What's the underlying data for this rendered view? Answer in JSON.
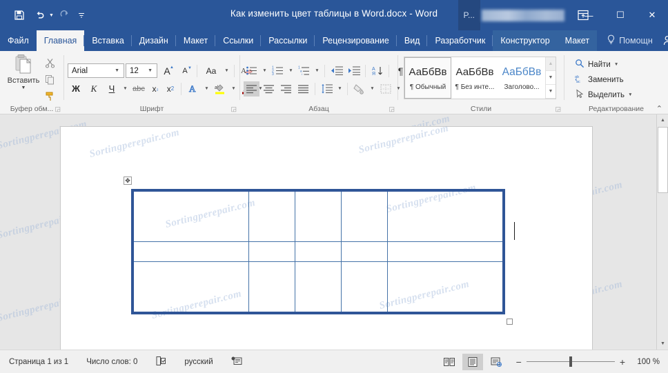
{
  "window": {
    "title": "Как изменить цвет таблицы в Word.docx  -  Word",
    "account_label": "P...",
    "quick_access": [
      {
        "name": "save",
        "icon": "save-icon"
      },
      {
        "name": "undo",
        "icon": "undo-icon"
      },
      {
        "name": "redo",
        "icon": "redo-icon"
      },
      {
        "name": "customize",
        "icon": "customize-qat-icon"
      }
    ],
    "controls": {
      "ribbon_display": "⊞",
      "minimize": "—",
      "maximize": "☐",
      "close": "✕"
    }
  },
  "tabs": [
    {
      "label": "Файл",
      "active": false
    },
    {
      "label": "Главная",
      "active": true
    },
    {
      "label": "Вставка",
      "active": false
    },
    {
      "label": "Дизайн",
      "active": false
    },
    {
      "label": "Макет",
      "active": false
    },
    {
      "label": "Ссылки",
      "active": false
    },
    {
      "label": "Рассылки",
      "active": false
    },
    {
      "label": "Рецензирование",
      "active": false
    },
    {
      "label": "Вид",
      "active": false
    },
    {
      "label": "Разработчик",
      "active": false
    }
  ],
  "contextual_tabs": [
    {
      "label": "Конструктор"
    },
    {
      "label": "Макет"
    }
  ],
  "helper": {
    "label": "Помощн",
    "icon": "lightbulb-icon"
  },
  "tabrow_icons": [
    {
      "name": "share-person-icon",
      "glyph": "⚲"
    },
    {
      "name": "comments-icon",
      "glyph": "▭"
    }
  ],
  "ribbon": {
    "clipboard": {
      "label": "Буфер обм...",
      "paste_label": "Вставить",
      "buttons": [
        {
          "name": "cut-button",
          "icon": "scissors-icon"
        },
        {
          "name": "copy-button",
          "icon": "copy-icon"
        },
        {
          "name": "format-painter-button",
          "icon": "format-painter-icon"
        }
      ]
    },
    "font": {
      "label": "Шрифт",
      "font_family": "Arial",
      "font_size": "12",
      "buttons": [
        {
          "name": "grow-font-button",
          "label": "A"
        },
        {
          "name": "shrink-font-button",
          "label": "A"
        },
        {
          "name": "change-case-button",
          "label": "Aa"
        },
        {
          "name": "clear-formatting-button",
          "label": "A"
        },
        {
          "name": "bold-button",
          "label": "Ж"
        },
        {
          "name": "italic-button",
          "label": "К"
        },
        {
          "name": "underline-button",
          "label": "Ч"
        },
        {
          "name": "strikethrough-button",
          "label": "abc"
        },
        {
          "name": "subscript-button",
          "label": "x₂"
        },
        {
          "name": "superscript-button",
          "label": "x²"
        },
        {
          "name": "text-effects-button",
          "label": "A"
        },
        {
          "name": "text-highlight-button",
          "label": "ab"
        },
        {
          "name": "font-color-button",
          "label": "A"
        }
      ],
      "highlight_color": "#ffff00",
      "font_color": "#9b0000"
    },
    "paragraph": {
      "label": "Абзац",
      "buttons": [
        {
          "name": "bullets-button"
        },
        {
          "name": "numbering-button"
        },
        {
          "name": "multilevel-list-button"
        },
        {
          "name": "decrease-indent-button"
        },
        {
          "name": "increase-indent-button"
        },
        {
          "name": "sort-button"
        },
        {
          "name": "show-formatting-marks-button"
        },
        {
          "name": "align-left-button"
        },
        {
          "name": "align-center-button"
        },
        {
          "name": "align-right-button"
        },
        {
          "name": "justify-button"
        },
        {
          "name": "line-spacing-button"
        },
        {
          "name": "shading-button"
        },
        {
          "name": "borders-button"
        }
      ]
    },
    "styles": {
      "label": "Стили",
      "items": [
        {
          "preview": "АаБбВв",
          "name": "¶ Обычный",
          "selected": true,
          "blue": false
        },
        {
          "preview": "АаБбВв",
          "name": "¶ Без инте...",
          "selected": false,
          "blue": false
        },
        {
          "preview": "АаБбВв",
          "name": "Заголово...",
          "selected": false,
          "blue": true
        }
      ]
    },
    "editing": {
      "label": "Редактирование",
      "items": [
        {
          "label": "Найти",
          "icon": "search-icon",
          "caret": true
        },
        {
          "label": "Заменить",
          "icon": "replace-icon",
          "caret": false
        },
        {
          "label": "Выделить",
          "icon": "select-icon",
          "caret": true
        }
      ]
    },
    "collapse_icon": "chevron-up-icon"
  },
  "document": {
    "watermark_text": "Sortingperepair.com",
    "table": {
      "rows": 3,
      "columns": 5,
      "border_color": "#2f5597",
      "grid_color": "#4472a8",
      "cells": [
        [
          "",
          "",
          "",
          "",
          ""
        ],
        [
          "",
          "",
          "",
          "",
          ""
        ],
        [
          "",
          "",
          "",
          "",
          ""
        ]
      ]
    }
  },
  "status": {
    "page": "Страница 1 из 1",
    "words": "Число слов: 0",
    "proofing_icon": "proofing-icon",
    "language": "русский",
    "macro_icon": "macro-record-icon",
    "views": [
      {
        "name": "read-mode-button",
        "active": false
      },
      {
        "name": "print-layout-button",
        "active": true
      },
      {
        "name": "web-layout-button",
        "active": false
      }
    ],
    "zoom_out": "−",
    "zoom_in": "+",
    "zoom_level": "100 %"
  }
}
